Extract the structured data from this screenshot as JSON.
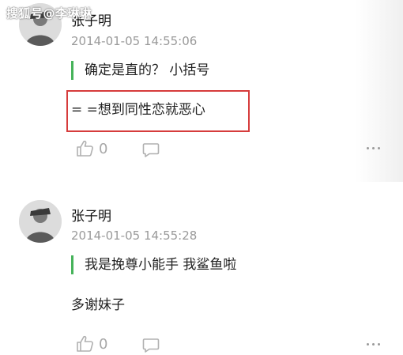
{
  "watermark": "搜狐号@李琳琳",
  "comments": [
    {
      "author": "张子明",
      "timestamp": "2014-01-05 14:55:06",
      "quote": "确定是直的？ 小括号",
      "reply": "= =想到同性恋就恶心",
      "likes": "0"
    },
    {
      "author": "张子明",
      "timestamp": "2014-01-05 14:55:28",
      "quote": "我是挽尊小能手 我鲨鱼啦",
      "reply": "多谢妹子",
      "likes": "0"
    }
  ],
  "icons": {
    "like": "thumbs-up-icon",
    "reply": "speech-bubble-icon",
    "more": "more-dots-icon"
  },
  "colors": {
    "quote_bar": "#46b35a",
    "highlight_box": "#d63c3c",
    "timestamp": "#9a9a9a"
  }
}
